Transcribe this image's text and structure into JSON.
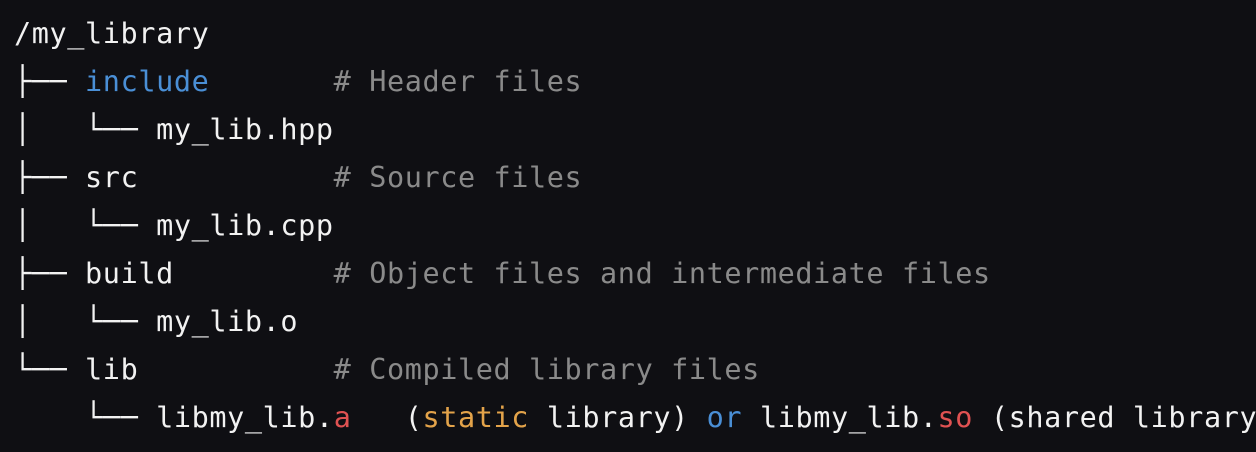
{
  "root": "/my_library",
  "tree": {
    "branch": "├── ",
    "last": "└── ",
    "pipe_indent": "│   ",
    "blank_indent": "    "
  },
  "lines": [
    {
      "name": "include",
      "comment": "# Header files",
      "pad": "       "
    },
    {
      "name": "my_lib.hpp"
    },
    {
      "name": "src",
      "comment": "# Source files",
      "pad": "           "
    },
    {
      "name": "my_lib.cpp"
    },
    {
      "name": "build",
      "comment": "# Object files and intermediate files",
      "pad": "         "
    },
    {
      "name": "my_lib.o"
    },
    {
      "name": "lib",
      "comment": "# Compiled library files",
      "pad": "           "
    }
  ],
  "last_line": {
    "static_base": "libmy_lib.",
    "static_ext": "a",
    "gap": "   ",
    "open_paren": "(",
    "static_word": "static",
    "static_rest": " library)",
    "or_word": "or",
    "shared_base": "libmy_lib.",
    "shared_ext": "so",
    "shared_text": "(shared library)"
  },
  "colors": {
    "background": "#0f0f13",
    "text": "#f2f2f2",
    "directory_highlight": "#4a8fd6",
    "comment": "#8a8a8a",
    "extension": "#e05252",
    "keyword_static": "#e3a34a",
    "keyword_or": "#4a8fd6"
  }
}
